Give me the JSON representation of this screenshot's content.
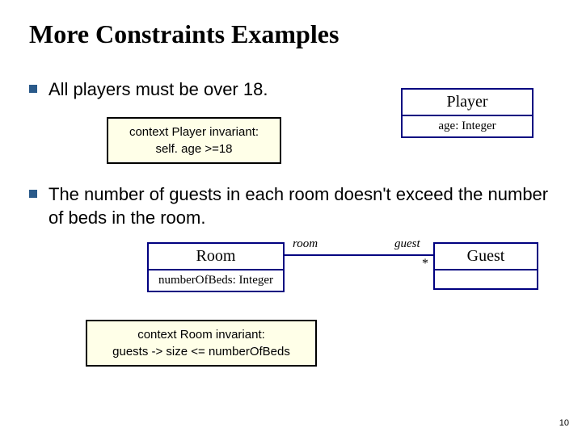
{
  "title": "More Constraints Examples",
  "page_number": "10",
  "bullets": [
    "All players must be over 18.",
    "The number of guests in each room doesn't exceed the number of beds in the room."
  ],
  "constraint1": {
    "line1": "context Player invariant:",
    "line2": "self. age >=18"
  },
  "constraint2": {
    "line1": "context Room invariant:",
    "line2": "guests -> size <= numberOfBeds"
  },
  "uml": {
    "player": {
      "name": "Player",
      "attr": "age: Integer"
    },
    "room": {
      "name": "Room",
      "attr": "numberOfBeds: Integer"
    },
    "guest": {
      "name": "Guest"
    },
    "assoc": {
      "left_role": "room",
      "right_role": "guest",
      "right_mult": "*"
    }
  }
}
